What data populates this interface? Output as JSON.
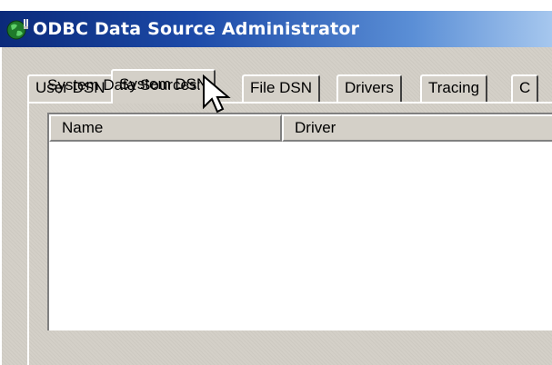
{
  "window": {
    "title": "ODBC Data Source Administrator",
    "title_icon": "odbc-globe-icon"
  },
  "tabs": [
    {
      "label": "User DSN",
      "selected": false
    },
    {
      "label": "System DSN",
      "selected": true
    },
    {
      "label": "File DSN",
      "selected": false
    },
    {
      "label": "Drivers",
      "selected": false
    },
    {
      "label": "Tracing",
      "selected": false
    },
    {
      "label": "C",
      "selected": false
    }
  ],
  "panel": {
    "label": "System Data Sources:",
    "columns": [
      "Name",
      "Driver"
    ],
    "rows": []
  },
  "colors": {
    "titlebar_start": "#0b2a7a",
    "titlebar_end": "#a6c7ee",
    "dialog_face": "#d4d0c8",
    "list_background": "#ffffff"
  },
  "cursor": {
    "icon": "mouse-pointer-icon"
  }
}
